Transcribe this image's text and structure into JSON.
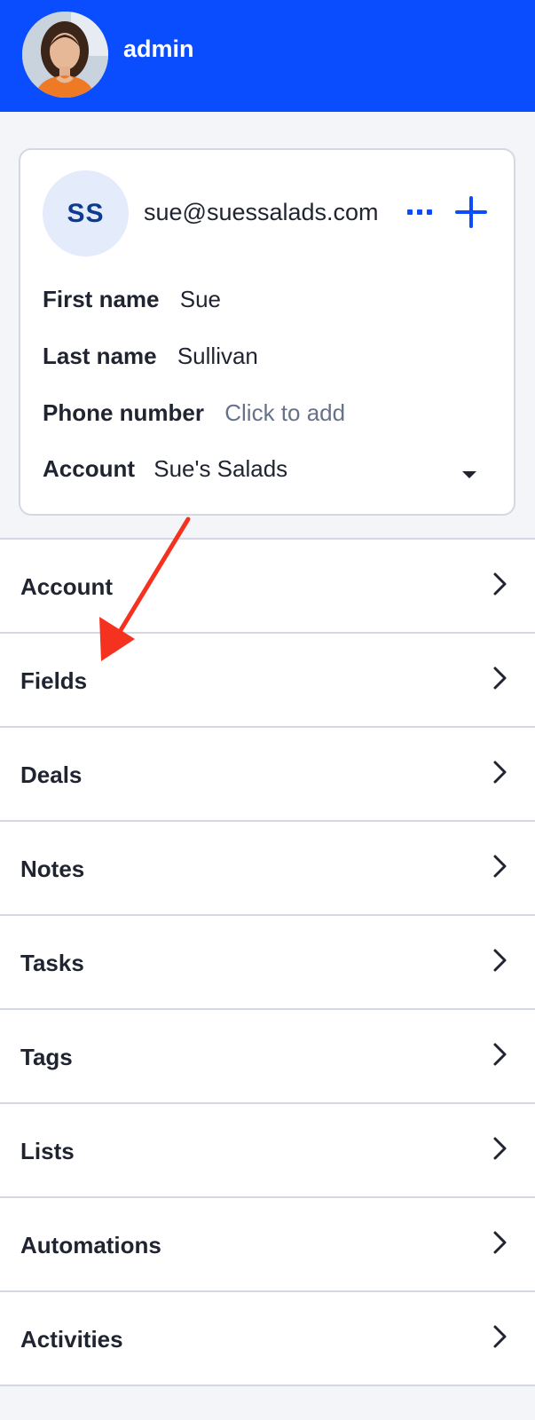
{
  "header": {
    "username": "admin",
    "background": "#0a4dff"
  },
  "contact": {
    "initials": "SS",
    "email": "sue@suessalads.com",
    "more_icon": "more-horizontal-icon",
    "add_icon": "plus-icon",
    "fields": {
      "first_name": {
        "label": "First name",
        "value": "Sue"
      },
      "last_name": {
        "label": "Last name",
        "value": "Sullivan"
      },
      "phone": {
        "label": "Phone number",
        "placeholder": "Click to add"
      },
      "account": {
        "label": "Account",
        "value": "Sue's Salads"
      }
    }
  },
  "nav": {
    "items": [
      {
        "label": "Account"
      },
      {
        "label": "Fields"
      },
      {
        "label": "Deals"
      },
      {
        "label": "Notes"
      },
      {
        "label": "Tasks"
      },
      {
        "label": "Tags"
      },
      {
        "label": "Lists"
      },
      {
        "label": "Automations"
      },
      {
        "label": "Activities"
      }
    ],
    "chevron_icon": "chevron-right-icon"
  },
  "colors": {
    "accent": "#0a4dff",
    "annotation_arrow": "#f5321f",
    "initials_bg": "#e4ebfa",
    "initials_text": "#0e3a8f"
  }
}
